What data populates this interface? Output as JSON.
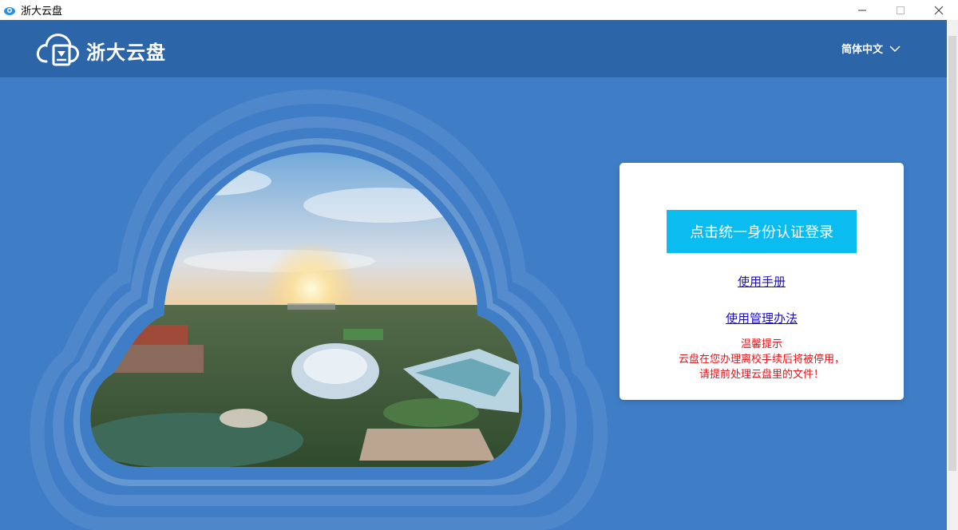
{
  "window": {
    "title": "浙大云盘",
    "icon": "cloud-app-icon",
    "controls": [
      "minimize",
      "maximize",
      "close"
    ]
  },
  "header": {
    "logo_text": "浙大云盘",
    "logo_icon": "cloud-download-icon",
    "language_label": "简体中文"
  },
  "login": {
    "button_label": "点击统一身份认证登录",
    "manual_link": "使用手册",
    "policy_link": "使用管理办法",
    "notice_title": "温馨提示",
    "notice_line1": "云盘在您办理离校手续后将被停用，",
    "notice_line2": "请提前处理云盘里的文件！"
  },
  "colors": {
    "header_bg": "#2c66a9",
    "main_bg": "#3f7dc6",
    "button_bg": "#0bbcf0",
    "link": "#1a0dcc",
    "notice": "#e1161d"
  }
}
